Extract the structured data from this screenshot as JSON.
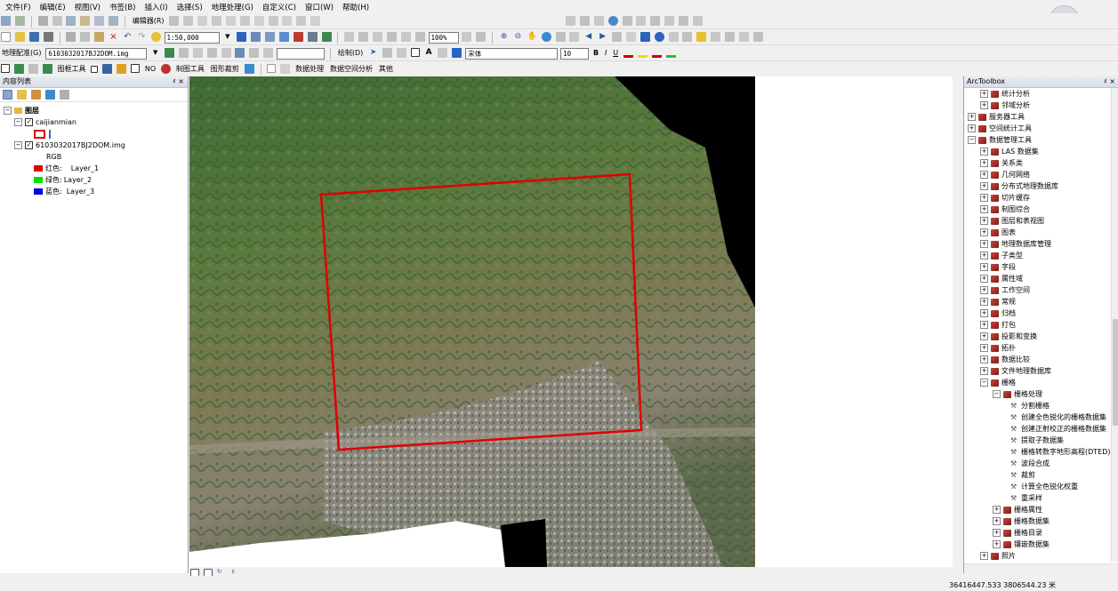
{
  "menu": [
    "文件(F)",
    "编辑(E)",
    "视图(V)",
    "书签(B)",
    "插入(I)",
    "选择(S)",
    "地理处理(G)",
    "自定义(C)",
    "窗口(W)",
    "帮助(H)"
  ],
  "toolbar1": {
    "editor_label": "编辑器(R)"
  },
  "toolbar2": {
    "scale": "1:50,000",
    "zoom_pct": "100%"
  },
  "toolbar3": {
    "georef_label": "地理配准(G)",
    "georef_layer": "6103032017BJ2DOM.img",
    "draw_label": "绘制(D)",
    "font_name": "宋体",
    "font_size": "10",
    "bold": "B",
    "italic": "I",
    "underline": "U"
  },
  "toolbar4": {
    "frame_tools": "图框工具",
    "no_label": "NO",
    "mapping_tools": "制图工具",
    "shape_tools": "图形裁剪",
    "data_processing": "数据处理",
    "spatial_analysis": "数据空间分析",
    "other": "其他"
  },
  "toc": {
    "title": "内容列表",
    "pin": "♯ ×",
    "root": "图层",
    "layer1": "caijianmian",
    "layer2": "6103032017BJ2DOM.img",
    "rgb": "RGB",
    "bands": [
      {
        "label": "红色:",
        "name": "Layer_1",
        "color": "#e00000"
      },
      {
        "label": "绿色:",
        "name": "Layer_2",
        "color": "#00e000"
      },
      {
        "label": "蓝色:",
        "name": "Layer_3",
        "color": "#0000e0"
      }
    ]
  },
  "toolbox": {
    "title": "ArcToolbox",
    "pin": "♯ ×",
    "items": [
      {
        "label": "统计分析",
        "level": 2,
        "kind": "toolset"
      },
      {
        "label": "邻域分析",
        "level": 2,
        "kind": "toolset"
      },
      {
        "label": "服务器工具",
        "level": 1,
        "kind": "toolbox"
      },
      {
        "label": "空间统计工具",
        "level": 1,
        "kind": "toolbox"
      },
      {
        "label": "数据管理工具",
        "level": 1,
        "kind": "toolbox",
        "open": true
      },
      {
        "label": "LAS 数据集",
        "level": 2,
        "kind": "toolset"
      },
      {
        "label": "关系类",
        "level": 2,
        "kind": "toolset"
      },
      {
        "label": "几何网络",
        "level": 2,
        "kind": "toolset"
      },
      {
        "label": "分布式地理数据库",
        "level": 2,
        "kind": "toolset"
      },
      {
        "label": "切片缓存",
        "level": 2,
        "kind": "toolset"
      },
      {
        "label": "制图综合",
        "level": 2,
        "kind": "toolset"
      },
      {
        "label": "图层和表视图",
        "level": 2,
        "kind": "toolset"
      },
      {
        "label": "图表",
        "level": 2,
        "kind": "toolset"
      },
      {
        "label": "地理数据库管理",
        "level": 2,
        "kind": "toolset"
      },
      {
        "label": "子类型",
        "level": 2,
        "kind": "toolset"
      },
      {
        "label": "字段",
        "level": 2,
        "kind": "toolset"
      },
      {
        "label": "属性域",
        "level": 2,
        "kind": "toolset"
      },
      {
        "label": "工作空间",
        "level": 2,
        "kind": "toolset"
      },
      {
        "label": "常规",
        "level": 2,
        "kind": "toolset"
      },
      {
        "label": "归档",
        "level": 2,
        "kind": "toolset"
      },
      {
        "label": "打包",
        "level": 2,
        "kind": "toolset"
      },
      {
        "label": "投影和变换",
        "level": 2,
        "kind": "toolset"
      },
      {
        "label": "拓扑",
        "level": 2,
        "kind": "toolset"
      },
      {
        "label": "数据比较",
        "level": 2,
        "kind": "toolset"
      },
      {
        "label": "文件地理数据库",
        "level": 2,
        "kind": "toolset"
      },
      {
        "label": "栅格",
        "level": 2,
        "kind": "toolset",
        "open": true
      },
      {
        "label": "栅格处理",
        "level": 3,
        "kind": "toolset",
        "open": true
      },
      {
        "label": "分割栅格",
        "level": 4,
        "kind": "tool"
      },
      {
        "label": "创建全色锐化的栅格数据集",
        "level": 4,
        "kind": "tool"
      },
      {
        "label": "创建正射校正的栅格数据集",
        "level": 4,
        "kind": "tool"
      },
      {
        "label": "提取子数据集",
        "level": 4,
        "kind": "tool"
      },
      {
        "label": "栅格转数字地形高程(DTED)",
        "level": 4,
        "kind": "tool"
      },
      {
        "label": "波段合成",
        "level": 4,
        "kind": "tool"
      },
      {
        "label": "裁剪",
        "level": 4,
        "kind": "tool"
      },
      {
        "label": "计算全色锐化权重",
        "level": 4,
        "kind": "tool"
      },
      {
        "label": "重采样",
        "level": 4,
        "kind": "tool"
      },
      {
        "label": "栅格属性",
        "level": 3,
        "kind": "toolset"
      },
      {
        "label": "栅格数据集",
        "level": 3,
        "kind": "toolset"
      },
      {
        "label": "栅格目录",
        "level": 3,
        "kind": "toolset"
      },
      {
        "label": "镶嵌数据集",
        "level": 3,
        "kind": "toolset"
      },
      {
        "label": "照片",
        "level": 2,
        "kind": "toolset"
      }
    ]
  },
  "status": {
    "coords": "36416447.533  3806544.23 米"
  }
}
